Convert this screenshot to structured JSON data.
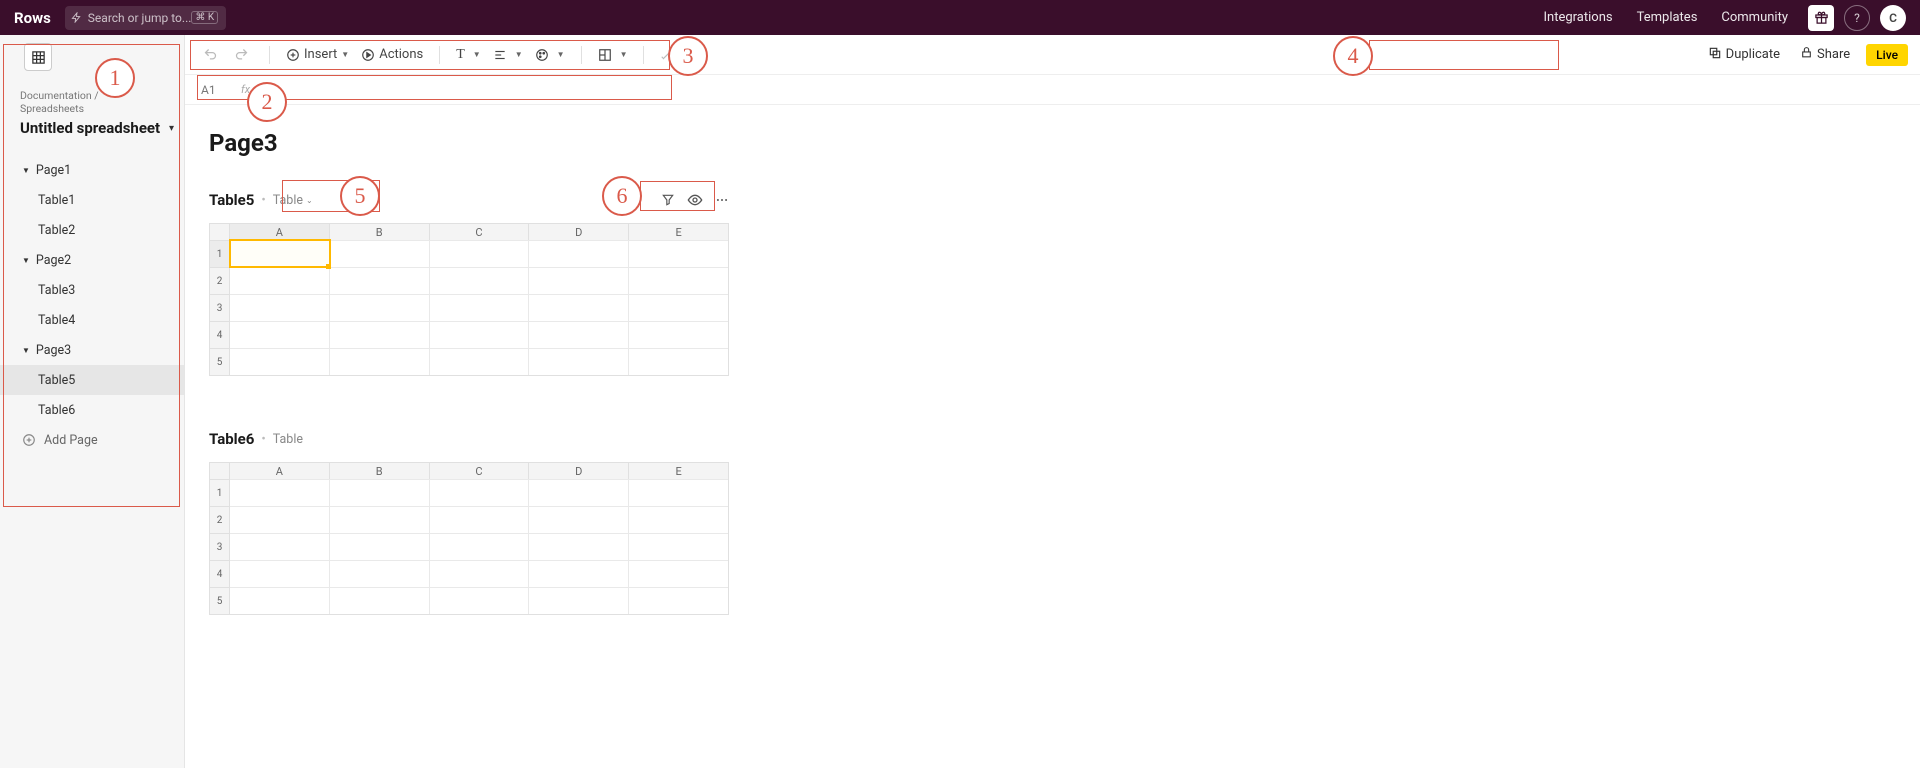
{
  "header": {
    "brand": "Rows",
    "search_placeholder": "Search or jump to...",
    "search_shortcut": "⌘ K",
    "links": {
      "integrations": "Integrations",
      "templates": "Templates",
      "community": "Community"
    },
    "avatar_initial": "C"
  },
  "sidebar": {
    "breadcrumb1": "Documentation",
    "breadcrumb2": "Spreadsheets",
    "doc_title": "Untitled spreadsheet",
    "pages": [
      {
        "label": "Page1",
        "tables": [
          "Table1",
          "Table2"
        ]
      },
      {
        "label": "Page2",
        "tables": [
          "Table3",
          "Table4"
        ]
      },
      {
        "label": "Page3",
        "tables": [
          "Table5",
          "Table6"
        ]
      }
    ],
    "active_table": "Table5",
    "add_page": "Add Page"
  },
  "toolbar": {
    "insert": "Insert",
    "actions": "Actions",
    "duplicate": "Duplicate",
    "share": "Share",
    "live": "Live"
  },
  "formula": {
    "ref": "A1",
    "fx": "fx"
  },
  "content": {
    "page_title": "Page3",
    "columns": [
      "A",
      "B",
      "C",
      "D",
      "E"
    ],
    "rows": [
      "1",
      "2",
      "3",
      "4",
      "5"
    ],
    "tables": [
      {
        "title": "Table5",
        "view": "Table",
        "selected_cell": "A1"
      },
      {
        "title": "Table6",
        "view": "Table"
      }
    ]
  },
  "annotations": {
    "1": "1",
    "2": "2",
    "3": "3",
    "4": "4",
    "5": "5",
    "6": "6"
  }
}
